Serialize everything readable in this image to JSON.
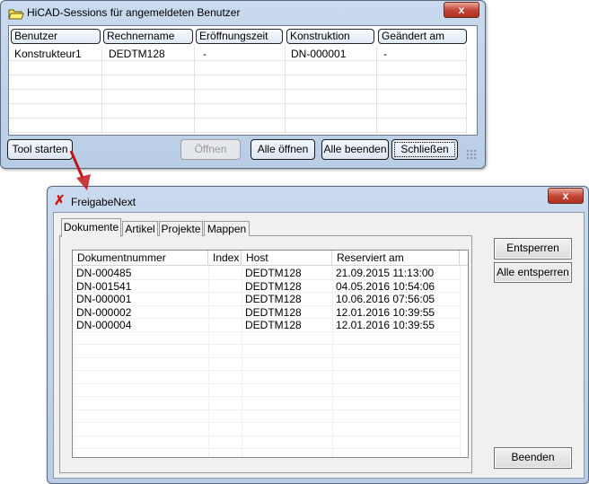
{
  "sessions": {
    "title": "HiCAD-Sessions für angemeldeten Benutzer",
    "close_label": "x",
    "columns": [
      "Benutzer",
      "Rechnername",
      "Eröffnungszeit",
      "Konstruktion",
      "Geändert am"
    ],
    "rows": [
      [
        "Konstrukteur1",
        "DEDTM128",
        "-",
        "DN-000001",
        "-"
      ]
    ],
    "buttons": {
      "tool": "Tool starten",
      "open": "Öffnen",
      "open_all": "Alle öffnen",
      "end_all": "Alle beenden",
      "close": "Schließen"
    }
  },
  "freigabe": {
    "title": "FreigabeNext",
    "close_label": "x",
    "tabs": [
      "Dokumente",
      "Artikel",
      "Projekte",
      "Mappen"
    ],
    "columns": [
      "Dokumentnummer",
      "Index",
      "Host",
      "Reserviert am"
    ],
    "rows": [
      [
        "DN-000485",
        "",
        "DEDTM128",
        "21.09.2015 11:13:00"
      ],
      [
        "DN-001541",
        "",
        "DEDTM128",
        "04.05.2016 10:54:06"
      ],
      [
        "DN-000001",
        "",
        "DEDTM128",
        "10.06.2016 07:56:05"
      ],
      [
        "DN-000002",
        "",
        "DEDTM128",
        "12.01.2016 10:39:55"
      ],
      [
        "DN-000004",
        "",
        "DEDTM128",
        "12.01.2016 10:39:55"
      ]
    ],
    "buttons": {
      "unlock": "Entsperren",
      "unlock_all": "Alle entsperren",
      "quit": "Beenden"
    }
  },
  "colors": {
    "arrow": "#c0161b"
  }
}
